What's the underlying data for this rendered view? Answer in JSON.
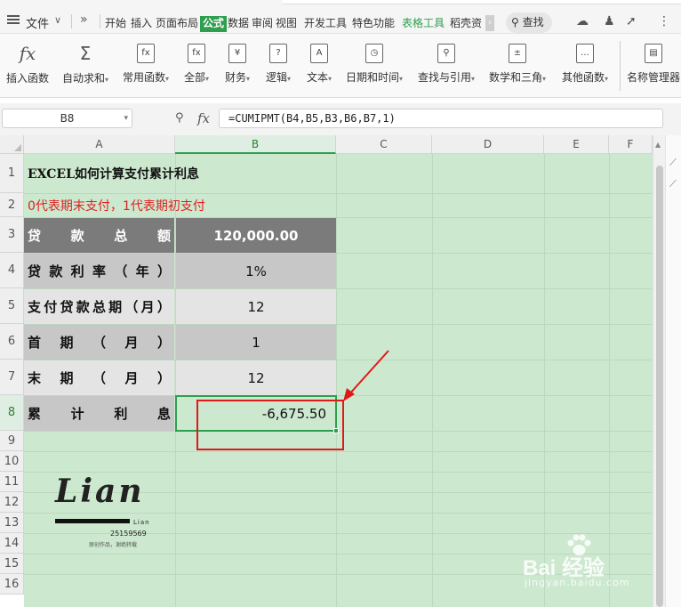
{
  "menubar": {
    "file_label": "文件",
    "tabs": [
      "开始",
      "插入",
      "页面布局",
      "公式",
      "数据",
      "审阅",
      "视图",
      "开发工具",
      "特色功能",
      "表格工具",
      "稻壳资"
    ],
    "active_tab": "公式",
    "search_label": "查找",
    "accent_color": "#2e9e4f"
  },
  "ribbon": {
    "buttons": [
      {
        "label": "插入函数",
        "icon": "fx"
      },
      {
        "label": "自动求和",
        "icon": "Σ"
      },
      {
        "label": "常用函数",
        "icon": "fx"
      },
      {
        "label": "全部",
        "icon": "fx"
      },
      {
        "label": "财务",
        "icon": "¥"
      },
      {
        "label": "逻辑",
        "icon": "?"
      },
      {
        "label": "文本",
        "icon": "A"
      },
      {
        "label": "日期和时间",
        "icon": "clock"
      },
      {
        "label": "查找与引用",
        "icon": "search"
      },
      {
        "label": "数学和三角",
        "icon": "math"
      },
      {
        "label": "其他函数",
        "icon": "more"
      },
      {
        "label": "名称管理器",
        "icon": "name"
      }
    ]
  },
  "formula_bar": {
    "name_box": "B8",
    "fx_label": "fx",
    "formula": "=CUMIPMT(B4,B5,B3,B6,B7,1)"
  },
  "columns": [
    "A",
    "B",
    "C",
    "D",
    "E",
    "F"
  ],
  "selected_column": "B",
  "rows": [
    "1",
    "2",
    "3",
    "4",
    "5",
    "6",
    "7",
    "8",
    "9",
    "10",
    "11",
    "12",
    "13",
    "14",
    "15",
    "16"
  ],
  "selected_row": "8",
  "sheet": {
    "title": "EXCEL如何计算支付累计利息",
    "note": "0代表期末支付，1代表期初支付",
    "table": [
      {
        "label": [
          "贷",
          "款",
          "总",
          "额"
        ],
        "value": "120,000.00",
        "style": "dark"
      },
      {
        "label": [
          "贷",
          "款",
          "利",
          "率",
          "（",
          "年",
          "）"
        ],
        "value": "1%",
        "style": "light"
      },
      {
        "label": [
          "支",
          "付",
          "贷",
          "款",
          "总",
          "期",
          "（",
          "月",
          "）"
        ],
        "value": "12",
        "style": "pale"
      },
      {
        "label": [
          "首",
          "期",
          "（",
          "月",
          "）"
        ],
        "value": "1",
        "style": "light"
      },
      {
        "label": [
          "末",
          "期",
          "（",
          "月",
          "）"
        ],
        "value": "12",
        "style": "pale"
      },
      {
        "label": [
          "累",
          "计",
          "利",
          "息"
        ],
        "value": "-6,675.50",
        "style": "result"
      }
    ]
  },
  "logo": {
    "word": "Lian",
    "small": "Lian",
    "number": "25159569",
    "sub": "原创作品，谢绝转载"
  },
  "watermark": {
    "main": "Bai 经验",
    "url": "jingyan.baidu.com"
  }
}
